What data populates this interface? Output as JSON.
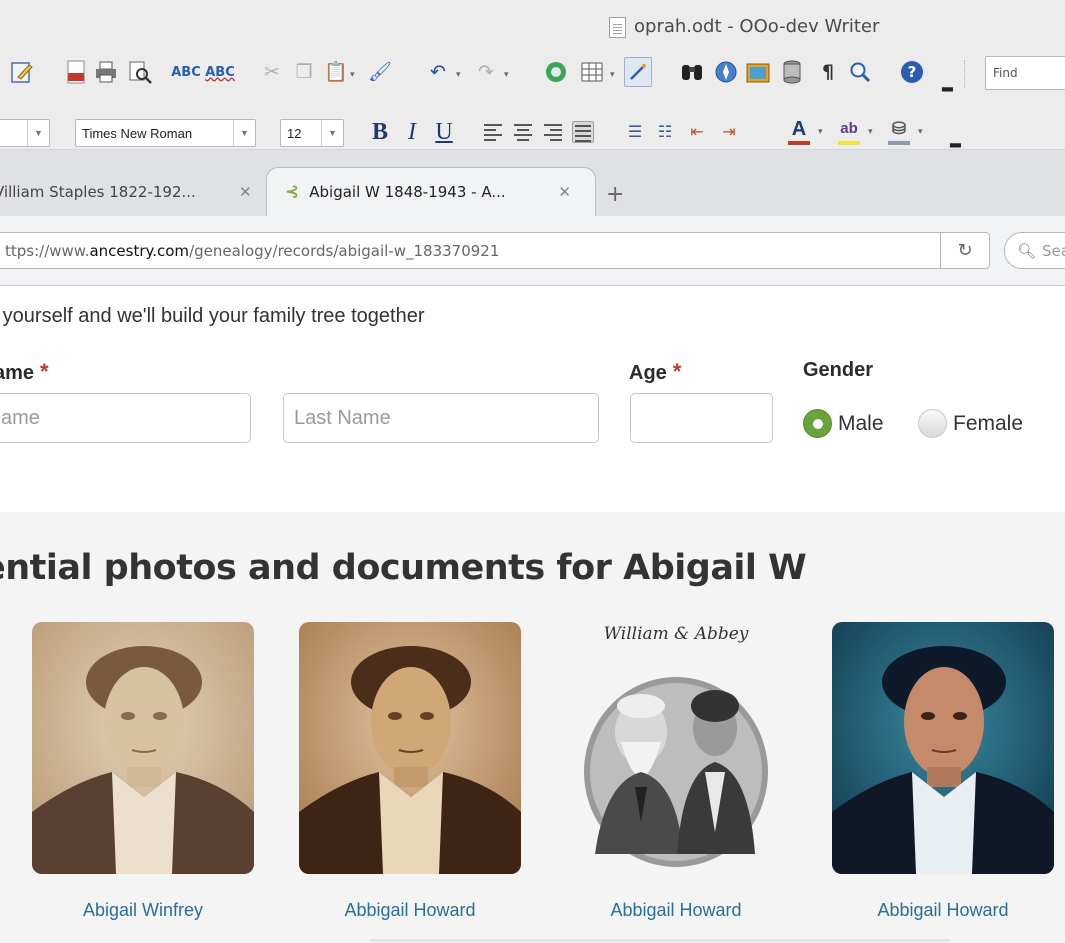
{
  "writer": {
    "window_title": "oprah.odt - OOo-dev Writer",
    "find_placeholder": "Find",
    "font_name": "Times New Roman",
    "font_size": "12",
    "para_style": "",
    "format_labels": {
      "bold": "B",
      "italic": "I",
      "underline": "U"
    },
    "colors": {
      "font_color": "#c0392b",
      "highlight": "#f1e33a",
      "background": "#8a9bb0"
    }
  },
  "browser": {
    "tabs": [
      {
        "title": "Villiam Staples 1822-192...",
        "active": false
      },
      {
        "title": "Abigail W 1848-1943 - A...",
        "active": true
      }
    ],
    "url_prefix": "ttps://www.",
    "url_host": "ancestry.com",
    "url_path": "/genealogy/records/abigail-w_183370921",
    "search_placeholder": "Sea"
  },
  "page": {
    "intro": "ith yourself and we'll build your family tree together",
    "name_label": "ame",
    "age_label": "Age",
    "gender_label": "Gender",
    "required_mark": "*",
    "first_name_placeholder": "ame",
    "last_name_placeholder": "Last Name",
    "gender_options": [
      {
        "label": "Male",
        "selected": true
      },
      {
        "label": "Female",
        "selected": false
      }
    ],
    "accent_green": "#6aa33a",
    "required_red": "#c0392b",
    "link_color": "#2a6f97"
  },
  "photos": {
    "title": "ential photos and documents for Abigail W",
    "items": [
      {
        "name": "Abigail Winfrey",
        "style": "sepia-light"
      },
      {
        "name": "Abbigail Howard",
        "style": "sepia-dark"
      },
      {
        "name": "Abbigail Howard",
        "style": "bw-couple",
        "caption": "William & Abbey"
      },
      {
        "name": "Abbigail Howard",
        "style": "colorized-blue"
      }
    ]
  }
}
